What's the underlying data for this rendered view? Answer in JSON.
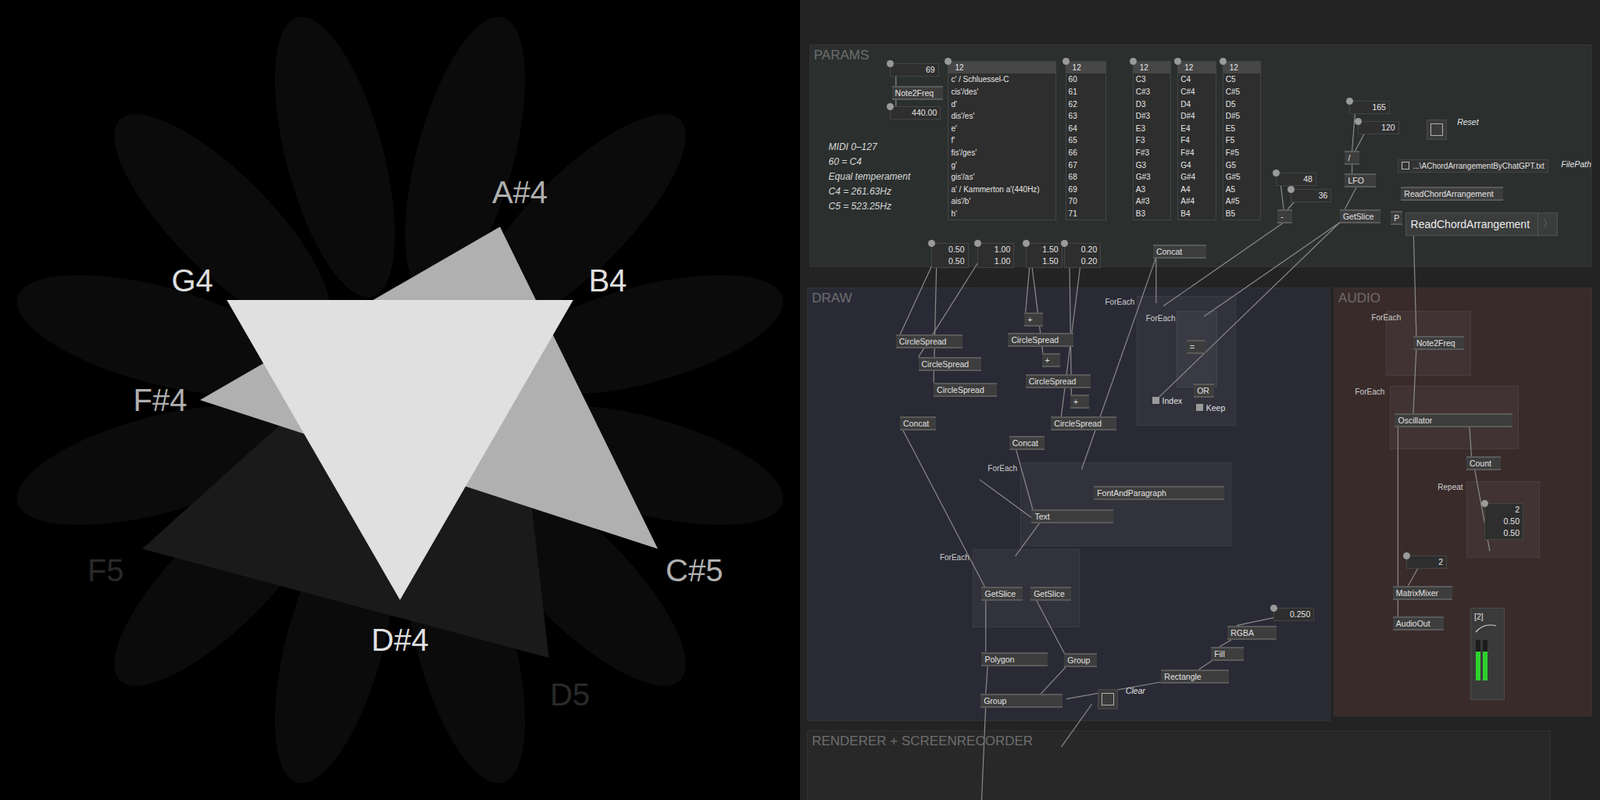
{
  "visualization": {
    "notes": [
      {
        "label": "A#4",
        "level": 0.69
      },
      {
        "label": "B4",
        "level": 0.88
      },
      {
        "label": "C#5",
        "level": 0.69
      },
      {
        "label": "D5",
        "level": 0.16
      },
      {
        "label": "D#4",
        "level": 0.88
      },
      {
        "label": "F5",
        "level": 0.16
      },
      {
        "label": "F#4",
        "level": 0.69
      },
      {
        "label": "G4",
        "level": 0.88
      }
    ],
    "chords": [
      {
        "notes": [
          "A#4",
          "D5",
          "F5"
        ],
        "level": 0.1
      },
      {
        "notes": [
          "A#4",
          "F#4",
          "C#5"
        ],
        "level": 0.69
      },
      {
        "notes": [
          "G4",
          "B4",
          "D#4"
        ],
        "level": 0.88
      }
    ]
  },
  "patch": {
    "regions": [
      {
        "title": "PARAMS"
      },
      {
        "title": "DRAW"
      },
      {
        "title": "AUDIO"
      },
      {
        "title": "RENDERER + SCREENRECORDER"
      }
    ],
    "comment": [
      "MIDI 0–127",
      "60 = C4",
      "Equal temperament",
      "C4 = 261.63Hz",
      "C5 = 523.25Hz"
    ],
    "nodes": [
      {
        "label": "Note2Freq"
      },
      {
        "label": "Concat"
      },
      {
        "label": "LFO"
      },
      {
        "label": "/"
      },
      {
        "label": "ReadChordArrangement"
      },
      {
        "label": "GetSlice"
      },
      {
        "label": "-"
      },
      {
        "label": "CircleSpread"
      },
      {
        "label": "CircleSpread"
      },
      {
        "label": "CircleSpread"
      },
      {
        "label": "Concat"
      },
      {
        "label": "+"
      },
      {
        "label": "CircleSpread"
      },
      {
        "label": "+"
      },
      {
        "label": "CircleSpread"
      },
      {
        "label": "+"
      },
      {
        "label": "CircleSpread"
      },
      {
        "label": "Concat"
      },
      {
        "label": "="
      },
      {
        "label": "OR"
      },
      {
        "label": "FontAndParagraph"
      },
      {
        "label": "Text"
      },
      {
        "label": "GetSlice"
      },
      {
        "label": "GetSlice"
      },
      {
        "label": "Polygon"
      },
      {
        "label": "Group"
      },
      {
        "label": "Group"
      },
      {
        "label": "RGBA"
      },
      {
        "label": "Fill"
      },
      {
        "label": "Rectangle"
      },
      {
        "label": "Note2Freq"
      },
      {
        "label": "Oscillator"
      },
      {
        "label": "Count"
      },
      {
        "label": "MatrixMixer"
      },
      {
        "label": "AudioOut"
      },
      {
        "label": "P"
      }
    ],
    "ioboxes": [
      {
        "values": [
          "69"
        ]
      },
      {
        "values": [
          "440.00"
        ]
      },
      {
        "values": [
          "0.50",
          "0.50"
        ]
      },
      {
        "values": [
          "1.00",
          "1.00"
        ]
      },
      {
        "values": [
          "1.50",
          "1.50"
        ]
      },
      {
        "values": [
          "0.20",
          "0.20"
        ]
      },
      {
        "values": [
          "48"
        ]
      },
      {
        "values": [
          "36"
        ]
      },
      {
        "values": [
          "165"
        ]
      },
      {
        "values": [
          "120"
        ]
      },
      {
        "values": [
          "0.250"
        ]
      },
      {
        "values": [
          "2",
          "0.50",
          "0.50"
        ]
      },
      {
        "values": [
          "2"
        ]
      }
    ],
    "spreads": [
      {
        "count": "12",
        "items": [
          "c' / Schluessel-C",
          "cis'/des'",
          "d'",
          "dis'/es'",
          "e'",
          "f'",
          "fis'/ges'",
          "g'",
          "gis'/as'",
          "a' / Kammerton a'(440Hz)",
          "ais'/b'",
          "h'"
        ]
      },
      {
        "count": "12",
        "items": [
          "60",
          "61",
          "62",
          "63",
          "64",
          "65",
          "66",
          "67",
          "68",
          "69",
          "70",
          "71"
        ]
      },
      {
        "count": "12",
        "items": [
          "C3",
          "C#3",
          "D3",
          "D#3",
          "E3",
          "F3",
          "F#3",
          "G3",
          "G#3",
          "A3",
          "A#3",
          "B3"
        ]
      },
      {
        "count": "12",
        "items": [
          "C4",
          "C#4",
          "D4",
          "D#4",
          "E4",
          "F4",
          "F#4",
          "G4",
          "G#4",
          "A4",
          "A#4",
          "B4"
        ]
      },
      {
        "count": "12",
        "items": [
          "C5",
          "C#5",
          "D5",
          "D#5",
          "E5",
          "F5",
          "F#5",
          "G5",
          "G#5",
          "A5",
          "A#5",
          "B5"
        ]
      }
    ],
    "loops": [
      {
        "label": "ForEach"
      },
      {
        "label": "ForEach"
      },
      {
        "label": "ForEach"
      },
      {
        "label": "ForEach"
      },
      {
        "label": "ForEach"
      },
      {
        "label": "ForEach"
      },
      {
        "label": "Repeat"
      }
    ],
    "pins": [
      {
        "label": "Index"
      },
      {
        "label": "Keep"
      }
    ],
    "toggles": [
      {
        "label": "Reset",
        "on": false
      },
      {
        "label": "Clear",
        "on": false
      }
    ],
    "file": {
      "path": "...\\AChordArrangementByChatGPT.txt",
      "label": "FilePath"
    },
    "button": {
      "label": "ReadChordArrangement",
      "arrow": "〉"
    },
    "meter": {
      "label": "[2]",
      "levels": [
        0.72,
        0.72
      ]
    }
  }
}
